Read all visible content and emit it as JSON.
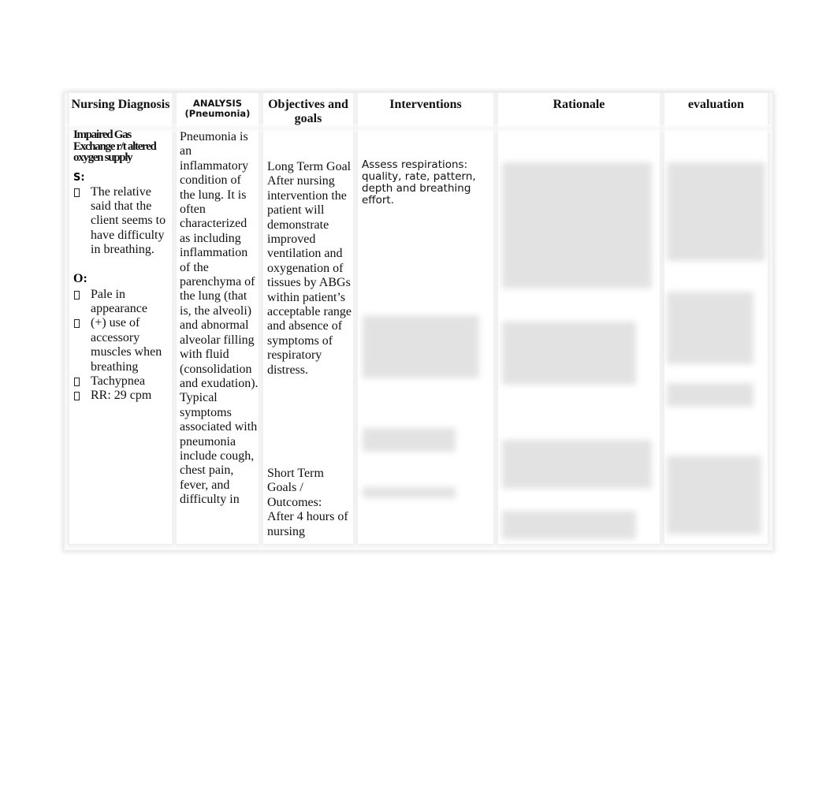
{
  "table": {
    "headers": {
      "nursing_diagnosis": "Nursing Diagnosis",
      "analysis": "ANALYSIS",
      "analysis_sub": "(Pneumonia)",
      "objectives": "Objectives and goals",
      "interventions": "Interventions",
      "rationale": "Rationale",
      "evaluation": "evaluation"
    },
    "diagnosis": {
      "title": "Impaired Gas Exchange r/t altered oxygen supply",
      "subjective_label": "S:",
      "subjective_items": [
        "The relative said that the client seems to have difficulty in breathing."
      ],
      "objective_label": "O:",
      "objective_items": [
        "Pale in appearance",
        "(+) use of accessory muscles when breathing",
        "Tachypnea",
        "RR: 29 cpm"
      ]
    },
    "analysis": {
      "text": "Pneumonia is an inflammatory condition of the lung. It is often characterized as including inflammation of the parenchyma of the lung (that is, the alveoli) and abnormal alveolar filling with fluid (consolidation and exudation). Typical symptoms associated with pneumonia include cough, chest pain, fever, and difficulty in"
    },
    "objectives": {
      "long_term_label": "Long Term Goal",
      "long_term_text": "After nursing intervention the patient will demonstrate improved ventilation and oxygenation of tissues by ABGs within patient’s acceptable range and absence of symptoms of respiratory distress.",
      "short_term_label": "Short Term Goals / Outcomes:",
      "short_term_text": "After 4 hours of nursing"
    },
    "interventions": {
      "items": [
        "Assess respirations: quality, rate, pattern, depth and breathing effort."
      ]
    }
  }
}
